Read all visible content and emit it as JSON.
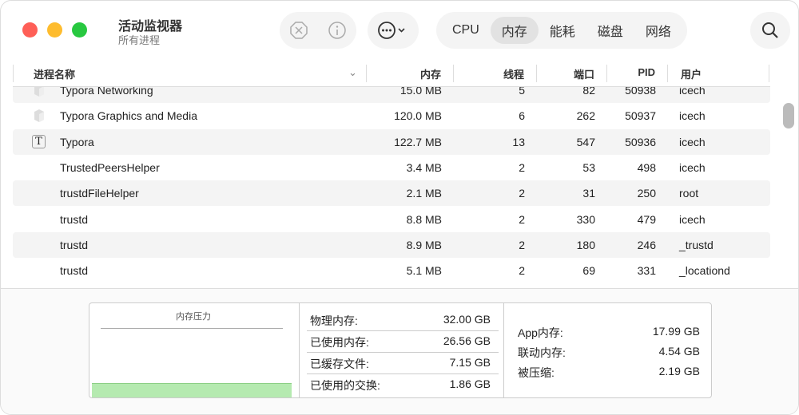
{
  "window": {
    "title": "活动监视器",
    "subtitle": "所有进程"
  },
  "toolbar": {
    "stop_icon": "x-octagon-icon",
    "info_icon": "info-icon",
    "more_icon": "ellipsis-circle-icon",
    "search_icon": "search-icon",
    "tabs": [
      {
        "label": "CPU",
        "active": false
      },
      {
        "label": "内存",
        "active": true
      },
      {
        "label": "能耗",
        "active": false
      },
      {
        "label": "磁盘",
        "active": false
      },
      {
        "label": "网络",
        "active": false
      }
    ]
  },
  "table": {
    "columns": [
      "进程名称",
      "内存",
      "线程",
      "端口",
      "PID",
      "用户"
    ],
    "rows": [
      {
        "name": "Typora Networking",
        "icon": "generic-app-icon",
        "mem": "15.0 MB",
        "threads": "5",
        "ports": "82",
        "pid": "50938",
        "user": "icech"
      },
      {
        "name": "Typora Graphics and Media",
        "icon": "generic-app-icon",
        "mem": "120.0 MB",
        "threads": "6",
        "ports": "262",
        "pid": "50937",
        "user": "icech"
      },
      {
        "name": "Typora",
        "icon": "typora-icon",
        "icon_text": "T",
        "mem": "122.7 MB",
        "threads": "13",
        "ports": "547",
        "pid": "50936",
        "user": "icech"
      },
      {
        "name": "TrustedPeersHelper",
        "mem": "3.4 MB",
        "threads": "2",
        "ports": "53",
        "pid": "498",
        "user": "icech"
      },
      {
        "name": "trustdFileHelper",
        "mem": "2.1 MB",
        "threads": "2",
        "ports": "31",
        "pid": "250",
        "user": "root"
      },
      {
        "name": "trustd",
        "mem": "8.8 MB",
        "threads": "2",
        "ports": "330",
        "pid": "479",
        "user": "icech"
      },
      {
        "name": "trustd",
        "mem": "8.9 MB",
        "threads": "2",
        "ports": "180",
        "pid": "246",
        "user": "_trustd"
      },
      {
        "name": "trustd",
        "mem": "5.1 MB",
        "threads": "2",
        "ports": "69",
        "pid": "331",
        "user": "_locationd"
      }
    ]
  },
  "summary": {
    "pressure_label": "内存压力",
    "pressure_color": "#b5eab0",
    "left": [
      {
        "k": "物理内存:",
        "v": "32.00 GB"
      },
      {
        "k": "已使用内存:",
        "v": "26.56 GB"
      },
      {
        "k": "已缓存文件:",
        "v": "7.15 GB"
      },
      {
        "k": "已使用的交换:",
        "v": "1.86 GB"
      }
    ],
    "right": [
      {
        "k": "App内存:",
        "v": "17.99 GB"
      },
      {
        "k": "联动内存:",
        "v": "4.54 GB"
      },
      {
        "k": "被压缩:",
        "v": "2.19 GB"
      }
    ]
  }
}
